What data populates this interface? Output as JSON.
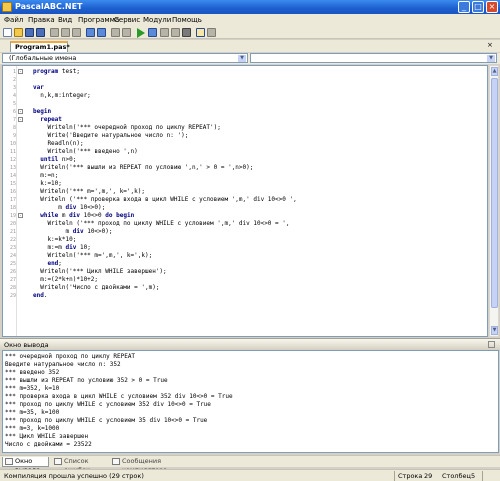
{
  "window": {
    "title": "PascalABC.NET"
  },
  "menu": [
    "Файл",
    "Правка",
    "Вид",
    "Программа",
    "Сервис",
    "Модули",
    "Помощь"
  ],
  "tab": {
    "label": "Program1.pas*"
  },
  "scope": {
    "left_value": "(Глобальные имена",
    "right_value": ""
  },
  "editor": {
    "line_numbers": [
      "1",
      "2",
      "3",
      "4",
      "5",
      "6",
      "7",
      "8",
      "9",
      "10",
      "11",
      "12",
      "13",
      "14",
      "15",
      "16",
      "17",
      "18",
      "19",
      "20",
      "21",
      "22",
      "23",
      "24",
      "25",
      "26",
      "27",
      "28",
      "29",
      "30",
      "31"
    ],
    "lines": [
      "program test;",
      "",
      "var",
      "  n,k,m:integer;",
      "",
      "begin",
      "  repeat",
      "    Writeln('*** очередной проход по циклу REPEAT');",
      "    Write('Введите натуральное число n: ');",
      "    Readln(n);",
      "    Writeln('*** введено ',n)",
      "  until n>0;",
      "  Writeln('*** вышли из REPEAT по условию ',n,' > 0 = ',n>0);",
      "  m:=n;",
      "  k:=10;",
      "  Writeln('*** m=',m,', k=',k);",
      "  Writeln ('*** проверка входа в цикл WHILE с условием ',m,' div 10<>0 ',",
      "       m div 10<>0);",
      "  while m div 10<>0 do begin",
      "    Writeln ('*** проход по циклу WHILE с условием ',m,' div 10<>0 = ',",
      "         m div 10<>0);",
      "    k:=k*10;",
      "    m:=m div 10;",
      "    Writeln('*** m=',m,', k=',k);",
      "    end;",
      "  Writeln('*** Цикл WHILE завершен');",
      "  m:=(2*k+n)*10+2;",
      "  Writeln('Число с двойками = ',m);",
      "end."
    ]
  },
  "output_panel": {
    "title": "Окно вывода",
    "lines": [
      "*** очередной проход по циклу REPEAT",
      "Введите натуральное число n: 352",
      "*** введено 352",
      "*** вышли из REPEAT по условию 352 > 0 = True",
      "*** m=352, k=10",
      "*** проверка входа в цикл WHILE с условием 352 div 10<>0 = True",
      "*** проход по циклу WHILE с условием 352 div 10<>0 = True",
      "*** m=35, k=100",
      "*** проход по циклу WHILE с условием 35 div 10<>0 = True",
      "*** m=3, k=1000",
      "*** Цикл WHILE завершен",
      "Число с двойками = 23522"
    ]
  },
  "bottom_tabs": [
    "Окно вывода",
    "Список ошибок",
    "Сообщения компилятора"
  ],
  "status": {
    "message": "Компиляция прошла успешно (29 строк)",
    "row_label": "Строка",
    "row_value": "29",
    "col_label": "Столбец",
    "col_value": "5"
  }
}
